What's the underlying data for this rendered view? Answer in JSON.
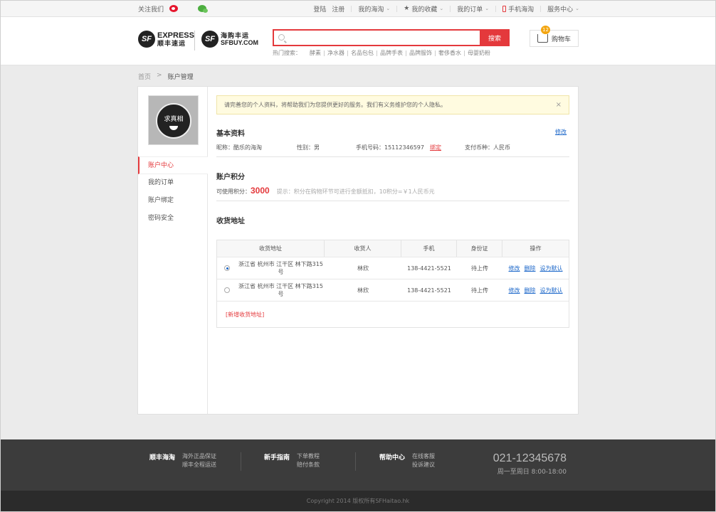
{
  "topbar": {
    "follow": "关注我们",
    "login": "登陆",
    "register": "注册",
    "my_haitao": "我的海淘",
    "favorites": "我的收藏",
    "orders": "我的订单",
    "mobile": "手机海淘",
    "service": "服务中心"
  },
  "logo": {
    "sf_mark": "SF",
    "express_en": "EXPRESS",
    "express_cn": "顺丰速运",
    "sfbuy_cn": "海购丰运",
    "sfbuy_en": "SFBUY.COM"
  },
  "search": {
    "placeholder": "",
    "button": "搜索",
    "hot_label": "热门搜索：",
    "hot_keywords": [
      "酵素",
      "净水器",
      "名品包包",
      "品牌手表",
      "品牌服饰",
      "奢侈香水",
      "母婴奶粉"
    ]
  },
  "cart": {
    "label": "购物车",
    "count": "12"
  },
  "breadcrumb": {
    "home": "首页",
    "sep": ">",
    "current": "账户管理"
  },
  "sidebar": {
    "avatar_text": "求真相",
    "items": [
      {
        "label": "账户中心",
        "active": true
      },
      {
        "label": "我的订单",
        "active": false
      },
      {
        "label": "账户绑定",
        "active": false
      },
      {
        "label": "密码安全",
        "active": false
      }
    ]
  },
  "notice": {
    "text": "请完善您的个人资料，将帮助我们为您提供更好的服务。我们有义务维护您的个人隐私。",
    "close": "×"
  },
  "basic": {
    "title": "基本资料",
    "edit": "修改",
    "nickname_label": "昵称：",
    "nickname": "酷乐的海淘",
    "gender_label": "性别：",
    "gender": "男",
    "phone_label": "手机号码：",
    "phone": "15112346597",
    "bind": "绑定",
    "currency_label": "支付币种：",
    "currency": "人民币"
  },
  "points": {
    "title": "账户积分",
    "label": "可使用积分：",
    "value": "3000",
    "tip": "提示：积分在购物环节可进行金额抵扣，10积分=￥1人民币元"
  },
  "address": {
    "title": "收货地址",
    "columns": [
      "收货地址",
      "收货人",
      "手机",
      "身份证",
      "操作"
    ],
    "rows": [
      {
        "selected": true,
        "addr": "浙江省  杭州市  江干区  林下路315号",
        "name": "林欣",
        "phone": "138-4421-5521",
        "id": "待上传"
      },
      {
        "selected": false,
        "addr": "浙江省  杭州市  江干区  林下路315号",
        "name": "林欣",
        "phone": "138-4421-5521",
        "id": "待上传"
      }
    ],
    "ops": {
      "edit": "修改",
      "delete": "删除",
      "default": "设为默认"
    },
    "add": "[新增收货地址]"
  },
  "footer": {
    "col1": {
      "title": "顺丰海淘",
      "links": [
        "海外正品保证",
        "顺丰全程运送"
      ]
    },
    "col2": {
      "title": "新手指南",
      "links": [
        "下单教程",
        "赔付条款"
      ]
    },
    "col3": {
      "title": "帮助中心",
      "links": [
        "在线客服",
        "投诉建议"
      ]
    },
    "phone": "021-12345678",
    "hours": "周一至周日 8:00-18:00",
    "copyright": "Copyright 2014 版权所有SFHaitao.hk"
  },
  "colors": {
    "accent": "#e4393c",
    "link": "#1a66c9",
    "footer_bg": "#3c3c3c"
  }
}
